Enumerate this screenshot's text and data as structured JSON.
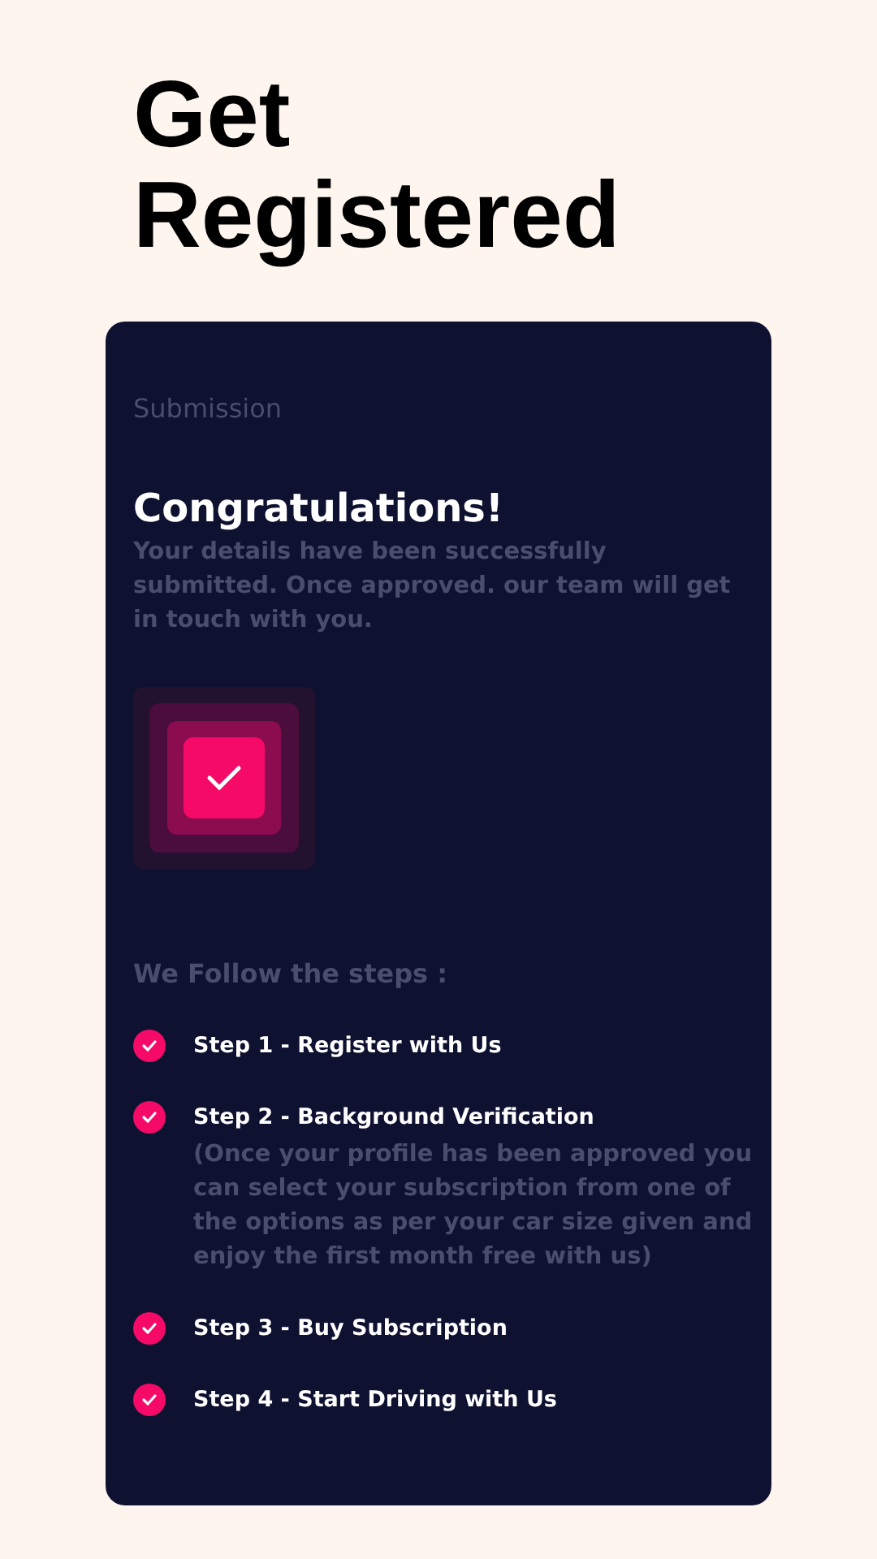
{
  "page_title": "Get Registered",
  "card": {
    "section_label": "Submission",
    "heading": "Congratulations!",
    "message": "Your details have been successfully submitted. Once approved. our team will get in touch with you.",
    "steps_heading": "We Follow the steps :",
    "steps": [
      {
        "label": "Step 1 - Register with Us",
        "checked": true
      },
      {
        "label": "Step 2 - Background Verification",
        "checked": true,
        "note": "(Once your profile has been approved you can select your subscription from one of the options as per your car size given and enjoy the first month free with us)"
      },
      {
        "label": "Step 3 - Buy Subscription",
        "checked": true
      },
      {
        "label": "Step 4 - Start Driving with Us",
        "checked": true
      }
    ]
  }
}
